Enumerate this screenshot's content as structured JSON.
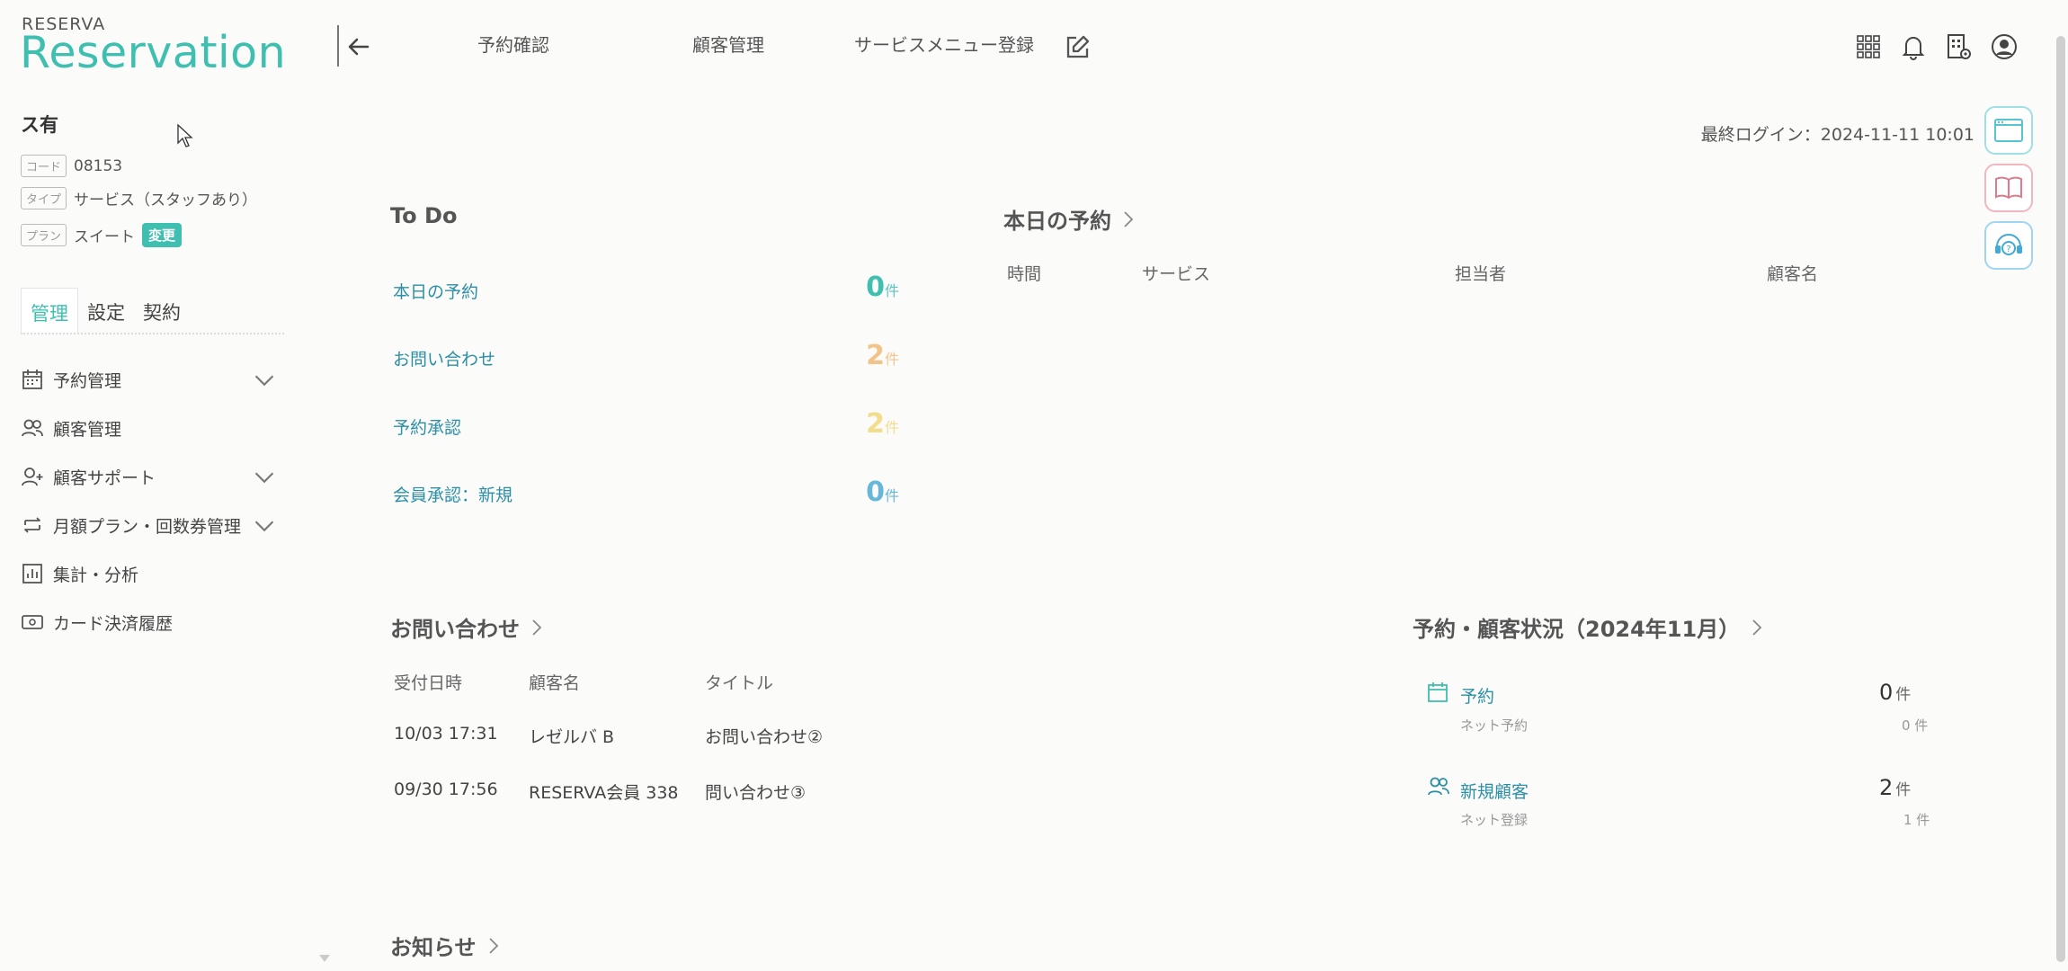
{
  "logo": {
    "small": "RESERVA",
    "big": "Reservation"
  },
  "topnav": [
    "予約確認",
    "顧客管理",
    "サービスメニュー登録"
  ],
  "top_icons": [
    "apps-grid-icon",
    "bell-icon",
    "building-gear-icon",
    "user-circle-icon"
  ],
  "account": {
    "name": "ス有",
    "code_tag": "コード",
    "code": "08153",
    "type_tag": "タイプ",
    "type": "サービス（スタッフあり）",
    "plan_tag": "プラン",
    "plan": "スイート",
    "change": "変更"
  },
  "sidebar": {
    "tabs": [
      "管理",
      "設定",
      "契約"
    ],
    "items": [
      {
        "label": "予約管理",
        "icon": "calendar-icon"
      },
      {
        "label": "顧客管理",
        "icon": "users-icon"
      },
      {
        "label": "顧客サポート",
        "icon": "user-plus-icon"
      },
      {
        "label": "月額プラン・回数券管理",
        "icon": "repeat-icon"
      },
      {
        "label": "集計・分析",
        "icon": "bar-chart-icon"
      },
      {
        "label": "カード決済履歴",
        "icon": "card-icon"
      }
    ]
  },
  "last_login": "最終ログイン：2024-11-11 10:01",
  "todo": {
    "title": "To Do",
    "unit": "件",
    "items": [
      {
        "label": "本日の予約",
        "count": "0",
        "color": "#3fbfb0"
      },
      {
        "label": "お問い合わせ",
        "count": "2",
        "color": "#f2c48a"
      },
      {
        "label": "予約承認",
        "count": "2",
        "color": "#f3dd8a"
      },
      {
        "label": "会員承認：新規",
        "count": "0",
        "color": "#67b7d8"
      }
    ]
  },
  "today": {
    "title": "本日の予約",
    "headers": [
      "時間",
      "サービス",
      "担当者",
      "顧客名"
    ]
  },
  "inquiries": {
    "title": "お問い合わせ",
    "headers": [
      "受付日時",
      "顧客名",
      "タイトル"
    ],
    "rows": [
      [
        "10/03 17:31",
        "レゼルバ B",
        "お問い合わせ②"
      ],
      [
        "09/30 17:56",
        "RESERVA会員 338",
        "問い合わせ③"
      ]
    ]
  },
  "status": {
    "title": "予約・顧客状況（2024年11月）",
    "items": [
      {
        "label": "予約",
        "sub": "ネット予約",
        "num": "0",
        "unit": "件",
        "subnum": "0 件",
        "icon": "calendar-icon"
      },
      {
        "label": "新規顧客",
        "sub": "ネット登録",
        "num": "2",
        "unit": "件",
        "subnum": "1 件",
        "icon": "users-icon"
      }
    ]
  },
  "notice": {
    "title": "お知らせ"
  }
}
